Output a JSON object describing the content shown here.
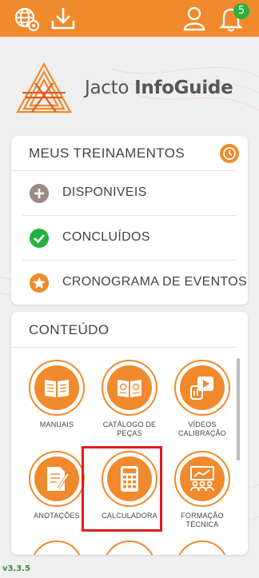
{
  "app": {
    "brand_light": "Jacto ",
    "brand_bold": "InfoGuide",
    "notification_count": "5",
    "version": "v3.3.5",
    "accent_color": "#f08a2c"
  },
  "topbar": {
    "icons": [
      "globe-settings-icon",
      "download-icon",
      "user-icon",
      "bell-icon"
    ]
  },
  "training": {
    "title": "MEUS TREINAMENTOS",
    "items": [
      {
        "label": "DISPONIVEIS",
        "icon": "plus-circle-icon",
        "color": "#9a8a86"
      },
      {
        "label": "CONCLUÍDOS",
        "icon": "check-circle-icon",
        "color": "#1fb33f"
      },
      {
        "label": "CRONOGRAMA DE EVENTOS",
        "icon": "star-circle-icon",
        "color": "#f08a2c"
      }
    ]
  },
  "content": {
    "title": "CONTEÚDO",
    "tiles": [
      {
        "label": "MANUAIS",
        "label2": "",
        "icon": "book-icon"
      },
      {
        "label": "CATÁLOGO DE",
        "label2": "PEÇAS",
        "icon": "catalog-icon"
      },
      {
        "label": "VÍDEOS",
        "label2": "CALIBRAÇÃO",
        "icon": "video-icon"
      },
      {
        "label": "ANOTAÇÕES",
        "label2": "",
        "icon": "notes-icon"
      },
      {
        "label": "CALCULADORA",
        "label2": "",
        "icon": "calculator-icon"
      },
      {
        "label": "FORMAÇÃO",
        "label2": "TÉCNICA",
        "icon": "classroom-icon"
      }
    ]
  }
}
